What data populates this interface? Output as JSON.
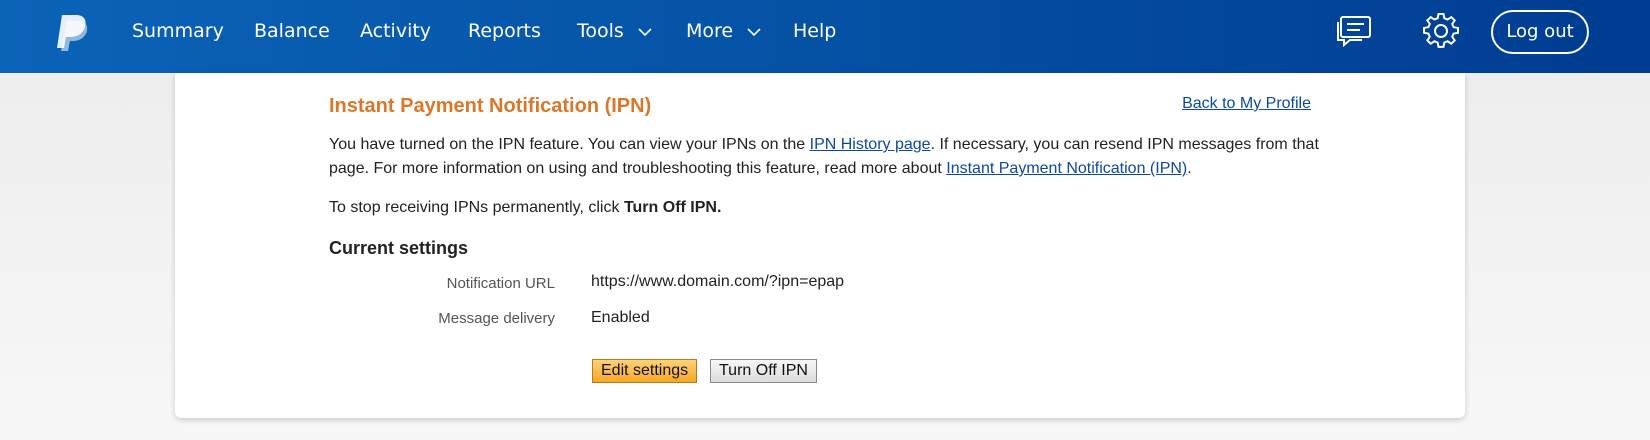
{
  "colors": {
    "header_gradient": [
      "#0b63b8",
      "#003c91"
    ],
    "title_orange": "#d9782a",
    "link_blue": "#0b4a9e",
    "primary_button": "#f6a823"
  },
  "header": {
    "logo_icon": "paypal-logo",
    "nav": [
      {
        "label": "Summary"
      },
      {
        "label": "Balance"
      },
      {
        "label": "Activity"
      },
      {
        "label": "Reports"
      },
      {
        "label": "Tools",
        "icon": "chevron-down-icon"
      },
      {
        "label": "More",
        "icon": "chevron-down-icon"
      },
      {
        "label": "Help"
      }
    ],
    "messages_icon": "message-center-icon",
    "settings_icon": "gear-icon",
    "logout_label": "Log out"
  },
  "content": {
    "title": "Instant Payment Notification (IPN)",
    "back_link": "Back to My Profile",
    "intro": {
      "part1": "You have turned on the IPN feature. You can view your IPNs on the ",
      "link1": "IPN History page",
      "part2": ". If necessary, you can resend IPN messages from that page. For more information on using and troubleshooting this feature, read more about ",
      "link2": "Instant Payment Notification (IPN)",
      "part3": "."
    },
    "stop": {
      "text": "To stop receiving IPNs permanently, click ",
      "bold": "Turn Off IPN."
    },
    "current_settings_title": "Current settings",
    "settings": [
      {
        "label": "Notification URL",
        "value": "https://www.domain.com/?ipn=epap"
      },
      {
        "label": "Message delivery",
        "value": "Enabled"
      }
    ],
    "buttons": {
      "edit": "Edit settings",
      "turn_off": "Turn Off IPN"
    }
  }
}
